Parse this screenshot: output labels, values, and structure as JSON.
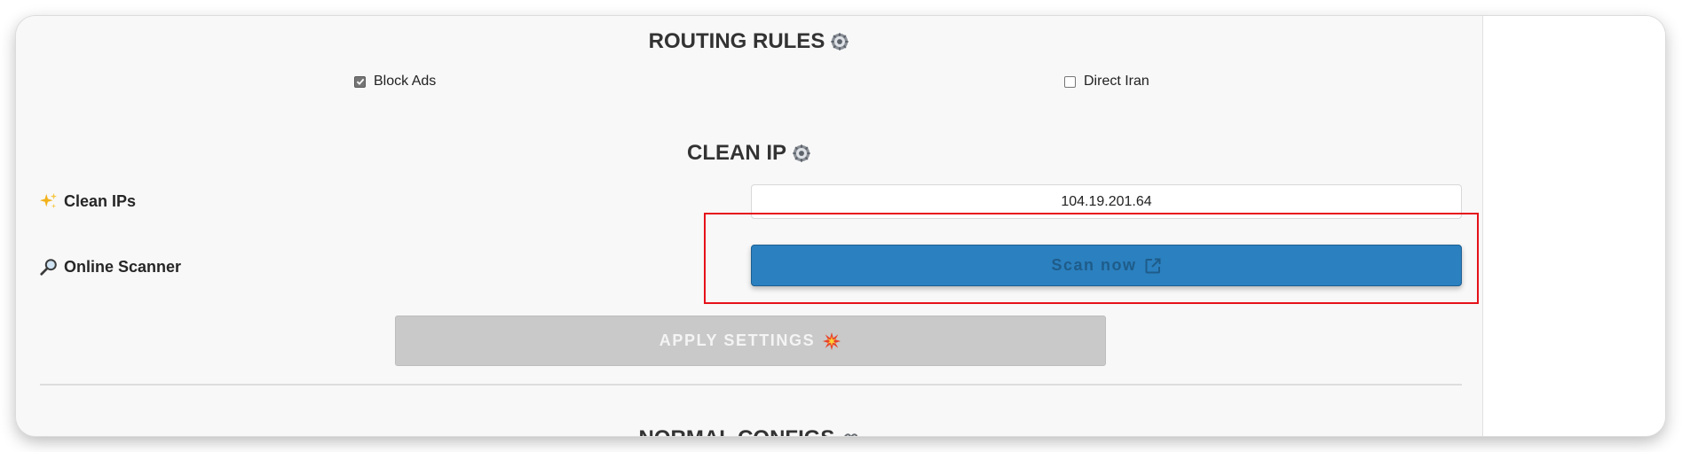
{
  "routing": {
    "title": "ROUTING RULES",
    "title_icon": "gear-icon",
    "options": [
      {
        "label": "Block Ads",
        "checked": true
      },
      {
        "label": "Direct Iran",
        "checked": false
      }
    ]
  },
  "clean_ip": {
    "title": "CLEAN IP",
    "title_icon": "gear-icon",
    "clean_ips_label": "Clean IPs",
    "clean_ips_icon": "sparkles-icon",
    "clean_ips_value": "104.19.201.64",
    "scanner_label": "Online Scanner",
    "scanner_icon": "magnifier-icon",
    "scan_button_label": "Scan now",
    "scan_button_icon": "external-link-icon"
  },
  "apply": {
    "label": "APPLY SETTINGS",
    "icon": "collision-icon"
  },
  "configs": {
    "title": "NORMAL CONFIGS",
    "title_icon": "link-icon"
  },
  "colors": {
    "primary_button": "#2b80bf",
    "disabled_button": "#c9c9c9",
    "highlight": "#e5121a"
  }
}
